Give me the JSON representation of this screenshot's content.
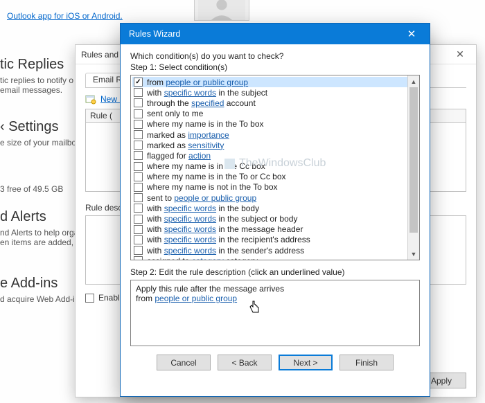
{
  "bg": {
    "link1_partial": "",
    "link2": "Outlook app for iOS or Android.",
    "sections": {
      "replies_heading": "tic Replies",
      "replies_text1": "tic replies to notify o",
      "replies_text2": "email messages.",
      "settings_heading": "‹ Settings",
      "settings_text": "e size of your mailbox",
      "storage": "3 free of 49.5 GB",
      "alerts_heading": "d Alerts",
      "alerts_text1": "nd Alerts to help orga",
      "alerts_text2": "en items are added, c",
      "addins_heading": "e Add-ins",
      "addins_text": "d acquire Web Add-in"
    }
  },
  "back_dialog": {
    "title": "Rules and A",
    "tab_label": "Email Rule",
    "new_rule": "New R",
    "rule_col": "Rule (",
    "rule_desc_label": "Rule desc",
    "enable_label": "Enable",
    "apply_btn": "Apply"
  },
  "wizard": {
    "title": "Rules Wizard",
    "question": "Which condition(s) do you want to check?",
    "step1": "Step 1: Select condition(s)",
    "step2": "Step 2: Edit the rule description (click an underlined value)",
    "desc_line1": "Apply this rule after the message arrives",
    "desc_line2_prefix": "from ",
    "desc_line2_link": "people or public group",
    "buttons": {
      "cancel": "Cancel",
      "back": "< Back",
      "next": "Next >",
      "finish": "Finish"
    }
  },
  "conditions": [
    {
      "checked": true,
      "selected": true,
      "parts": [
        {
          "t": "from "
        },
        {
          "t": "people or public group",
          "u": true
        }
      ]
    },
    {
      "checked": false,
      "selected": false,
      "parts": [
        {
          "t": "with "
        },
        {
          "t": "specific words",
          "u": true
        },
        {
          "t": " in the subject"
        }
      ]
    },
    {
      "checked": false,
      "selected": false,
      "parts": [
        {
          "t": "through the "
        },
        {
          "t": "specified",
          "u": true
        },
        {
          "t": " account"
        }
      ]
    },
    {
      "checked": false,
      "selected": false,
      "parts": [
        {
          "t": "sent only to me"
        }
      ]
    },
    {
      "checked": false,
      "selected": false,
      "parts": [
        {
          "t": "where my name is in the To box"
        }
      ]
    },
    {
      "checked": false,
      "selected": false,
      "parts": [
        {
          "t": "marked as "
        },
        {
          "t": "importance",
          "u": true
        }
      ]
    },
    {
      "checked": false,
      "selected": false,
      "parts": [
        {
          "t": "marked as "
        },
        {
          "t": "sensitivity",
          "u": true
        }
      ]
    },
    {
      "checked": false,
      "selected": false,
      "parts": [
        {
          "t": "flagged for "
        },
        {
          "t": "action",
          "u": true
        }
      ]
    },
    {
      "checked": false,
      "selected": false,
      "parts": [
        {
          "t": "where my name is in the Cc box"
        }
      ]
    },
    {
      "checked": false,
      "selected": false,
      "parts": [
        {
          "t": "where my name is in the To or Cc box"
        }
      ]
    },
    {
      "checked": false,
      "selected": false,
      "parts": [
        {
          "t": "where my name is not in the To box"
        }
      ]
    },
    {
      "checked": false,
      "selected": false,
      "parts": [
        {
          "t": "sent to "
        },
        {
          "t": "people or public group",
          "u": true
        }
      ]
    },
    {
      "checked": false,
      "selected": false,
      "parts": [
        {
          "t": "with "
        },
        {
          "t": "specific words",
          "u": true
        },
        {
          "t": " in the body"
        }
      ]
    },
    {
      "checked": false,
      "selected": false,
      "parts": [
        {
          "t": "with "
        },
        {
          "t": "specific words",
          "u": true
        },
        {
          "t": " in the subject or body"
        }
      ]
    },
    {
      "checked": false,
      "selected": false,
      "parts": [
        {
          "t": "with "
        },
        {
          "t": "specific words",
          "u": true
        },
        {
          "t": " in the message header"
        }
      ]
    },
    {
      "checked": false,
      "selected": false,
      "parts": [
        {
          "t": "with "
        },
        {
          "t": "specific words",
          "u": true
        },
        {
          "t": " in the recipient's address"
        }
      ]
    },
    {
      "checked": false,
      "selected": false,
      "parts": [
        {
          "t": "with "
        },
        {
          "t": "specific words",
          "u": true
        },
        {
          "t": " in the sender's address"
        }
      ]
    },
    {
      "checked": false,
      "selected": false,
      "parts": [
        {
          "t": "assigned to "
        },
        {
          "t": "category",
          "u": true
        },
        {
          "t": " category"
        }
      ]
    }
  ],
  "watermark": "TheWindowsClub"
}
